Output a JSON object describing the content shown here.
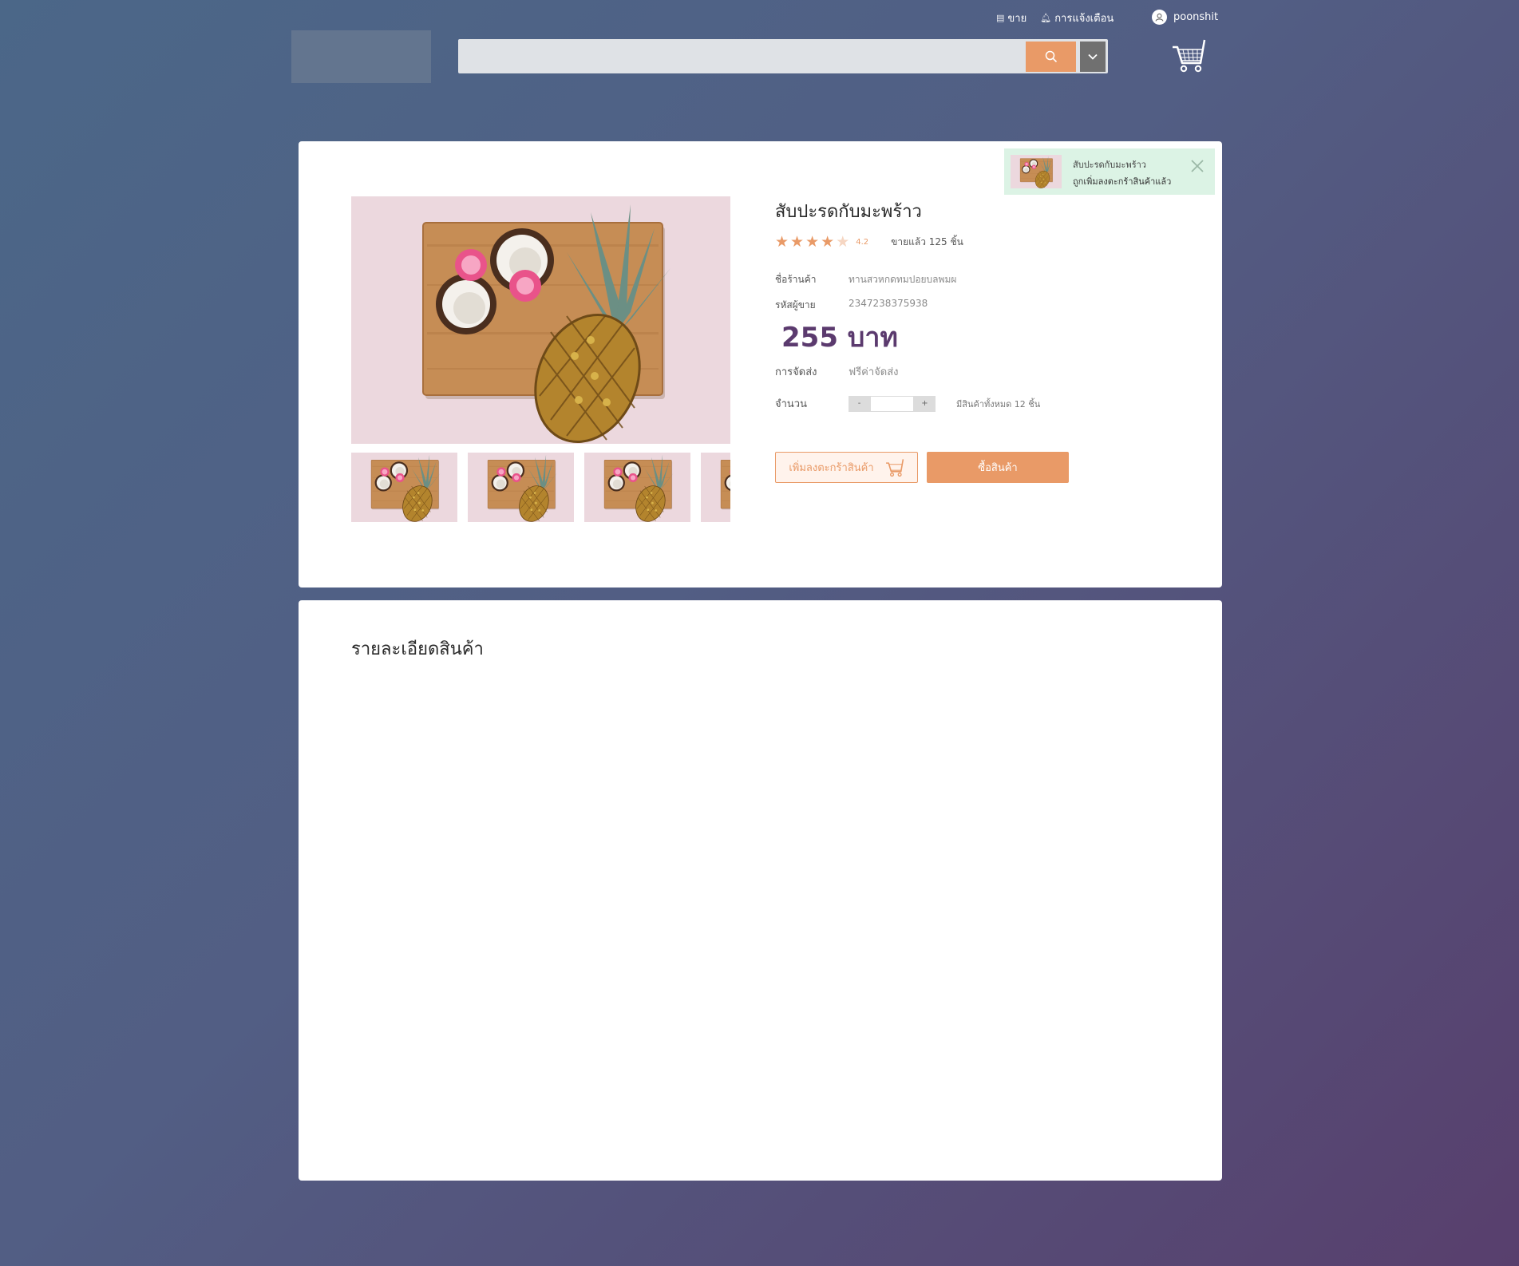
{
  "top_links": {
    "sell_label": "ขาย",
    "notifications_label": "การแจ้งเตือน",
    "username": "poonshit"
  },
  "search": {
    "value": "",
    "placeholder": ""
  },
  "product": {
    "title": "สับปะรดกับมะพร้าว",
    "rating_value": 4.2,
    "rating_label": "4.2",
    "rating_stars_max": 5,
    "sold_text": "ขายแล้ว 125 ชิ้น",
    "shop_label": "ชื่อร้านค้า",
    "shop_value": "ทานสวหกดทมปอยบลพมผ",
    "seller_id_label": "รหัสผู้ขาย",
    "seller_id_value": "2347238375938",
    "price": "255 บาท",
    "shipping_label": "การจัดส่ง",
    "shipping_value": "ฟรีค่าจัดส่ง",
    "qty_label": "จำนวน",
    "qty_minus": "-",
    "qty_plus": "+",
    "qty_value": "",
    "stock_text": "มีสินค้าทั้งหมด 12 ชิ้น",
    "add_to_cart_label": "เพิ่มลงตะกร้าสินค้า",
    "buy_label": "ซื้อสินค้า"
  },
  "toast": {
    "line1": "สับปะรดกับมะพร้าว",
    "line2": "ถูกเพิ่มลงตะกร้าสินค้าแล้ว"
  },
  "details": {
    "title": "รายละเอียดสินค้า"
  },
  "colors": {
    "accent": "#e99a67",
    "price": "#5b3a6e",
    "toast_bg": "#dcf3e5",
    "dropdown": "#707070"
  },
  "icons": {
    "sell": "store-icon",
    "notifications": "bell-icon",
    "user": "user-icon",
    "search": "search-icon",
    "dropdown": "chevron-down-icon",
    "cart": "cart-icon",
    "close": "close-icon",
    "star": "star-icon"
  }
}
